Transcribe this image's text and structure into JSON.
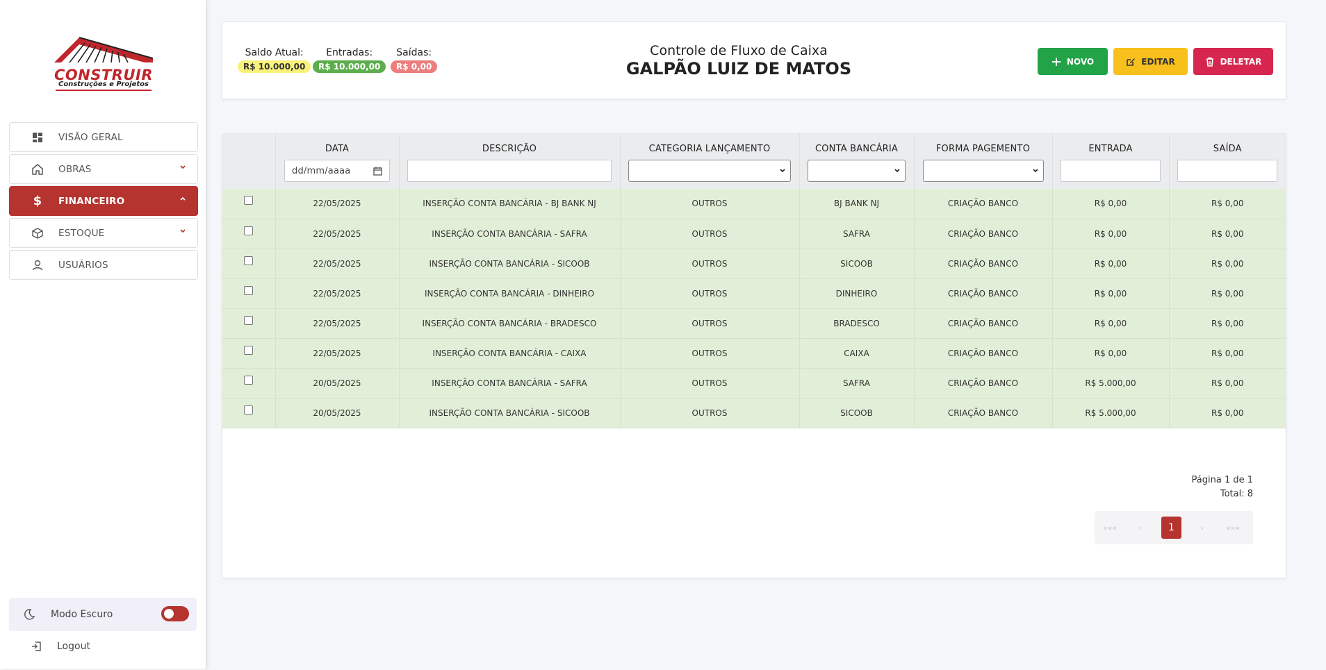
{
  "brand": {
    "name": "CONSTRUIR",
    "tagline": "Construções e Projetos",
    "color": "#c0272d"
  },
  "sidebar": {
    "items": [
      {
        "label": "VISÃO GERAL",
        "icon": "dashboard-icon"
      },
      {
        "label": "OBRAS",
        "icon": "home-icon",
        "expanded": false
      },
      {
        "label": "FINANCEIRO",
        "icon": "dollar-icon",
        "active": true,
        "expanded": true
      },
      {
        "label": "ESTOQUE",
        "icon": "box-icon",
        "expanded": false
      },
      {
        "label": "USUÁRIOS",
        "icon": "user-icon"
      }
    ],
    "dark_mode_label": "Modo Escuro",
    "dark_mode_on": true,
    "logout_label": "Logout"
  },
  "header": {
    "saldo_label": "Saldo Atual:",
    "saldo_value": "R$ 10.000,00",
    "entradas_label": "Entradas:",
    "entradas_value": "R$ 10.000,00",
    "saidas_label": "Saídas:",
    "saidas_value": "R$ 0,00",
    "subtitle": "Controle de Fluxo de Caixa",
    "title": "GALPÃO LUIZ DE MATOS",
    "new_label": "NOVO",
    "edit_label": "EDITAR",
    "delete_label": "DELETAR"
  },
  "table": {
    "columns": [
      "DATA",
      "DESCRIÇÃO",
      "CATEGORIA LANÇAMENTO",
      "CONTA BANCÁRIA",
      "FORMA PAGEMENTO",
      "ENTRADA",
      "SAÍDA"
    ],
    "date_placeholder": "dd/mm/aaaa",
    "rows": [
      {
        "data": "22/05/2025",
        "descricao": "INSERÇÃO CONTA BANCÁRIA - BJ BANK NJ",
        "categoria": "OUTROS",
        "conta": "BJ BANK NJ",
        "forma": "CRIAÇÃO BANCO",
        "entrada": "R$ 0,00",
        "saida": "R$ 0,00"
      },
      {
        "data": "22/05/2025",
        "descricao": "INSERÇÃO CONTA BANCÁRIA - SAFRA",
        "categoria": "OUTROS",
        "conta": "SAFRA",
        "forma": "CRIAÇÃO BANCO",
        "entrada": "R$ 0,00",
        "saida": "R$ 0,00"
      },
      {
        "data": "22/05/2025",
        "descricao": "INSERÇÃO CONTA BANCÁRIA - SICOOB",
        "categoria": "OUTROS",
        "conta": "SICOOB",
        "forma": "CRIAÇÃO BANCO",
        "entrada": "R$ 0,00",
        "saida": "R$ 0,00"
      },
      {
        "data": "22/05/2025",
        "descricao": "INSERÇÃO CONTA BANCÁRIA - DINHEIRO",
        "categoria": "OUTROS",
        "conta": "DINHEIRO",
        "forma": "CRIAÇÃO BANCO",
        "entrada": "R$ 0,00",
        "saida": "R$ 0,00"
      },
      {
        "data": "22/05/2025",
        "descricao": "INSERÇÃO CONTA BANCÁRIA - BRADESCO",
        "categoria": "OUTROS",
        "conta": "BRADESCO",
        "forma": "CRIAÇÃO BANCO",
        "entrada": "R$ 0,00",
        "saida": "R$ 0,00"
      },
      {
        "data": "22/05/2025",
        "descricao": "INSERÇÃO CONTA BANCÁRIA - CAIXA",
        "categoria": "OUTROS",
        "conta": "CAIXA",
        "forma": "CRIAÇÃO BANCO",
        "entrada": "R$ 0,00",
        "saida": "R$ 0,00"
      },
      {
        "data": "20/05/2025",
        "descricao": "INSERÇÃO CONTA BANCÁRIA - SAFRA",
        "categoria": "OUTROS",
        "conta": "SAFRA",
        "forma": "CRIAÇÃO BANCO",
        "entrada": "R$ 5.000,00",
        "saida": "R$ 0,00"
      },
      {
        "data": "20/05/2025",
        "descricao": "INSERÇÃO CONTA BANCÁRIA - SICOOB",
        "categoria": "OUTROS",
        "conta": "SICOOB",
        "forma": "CRIAÇÃO BANCO",
        "entrada": "R$ 5.000,00",
        "saida": "R$ 0,00"
      }
    ]
  },
  "pagination": {
    "page_info": "Página 1 de 1",
    "total": "Total: 8",
    "first": "«««",
    "prev": "‹",
    "current": "1",
    "next": "›",
    "last": "»»»"
  },
  "colors": {
    "accent": "#b5342f",
    "new": "#22a347",
    "edit": "#f7c01c",
    "delete": "#d6264f",
    "row_bg": "#e2efd8"
  }
}
